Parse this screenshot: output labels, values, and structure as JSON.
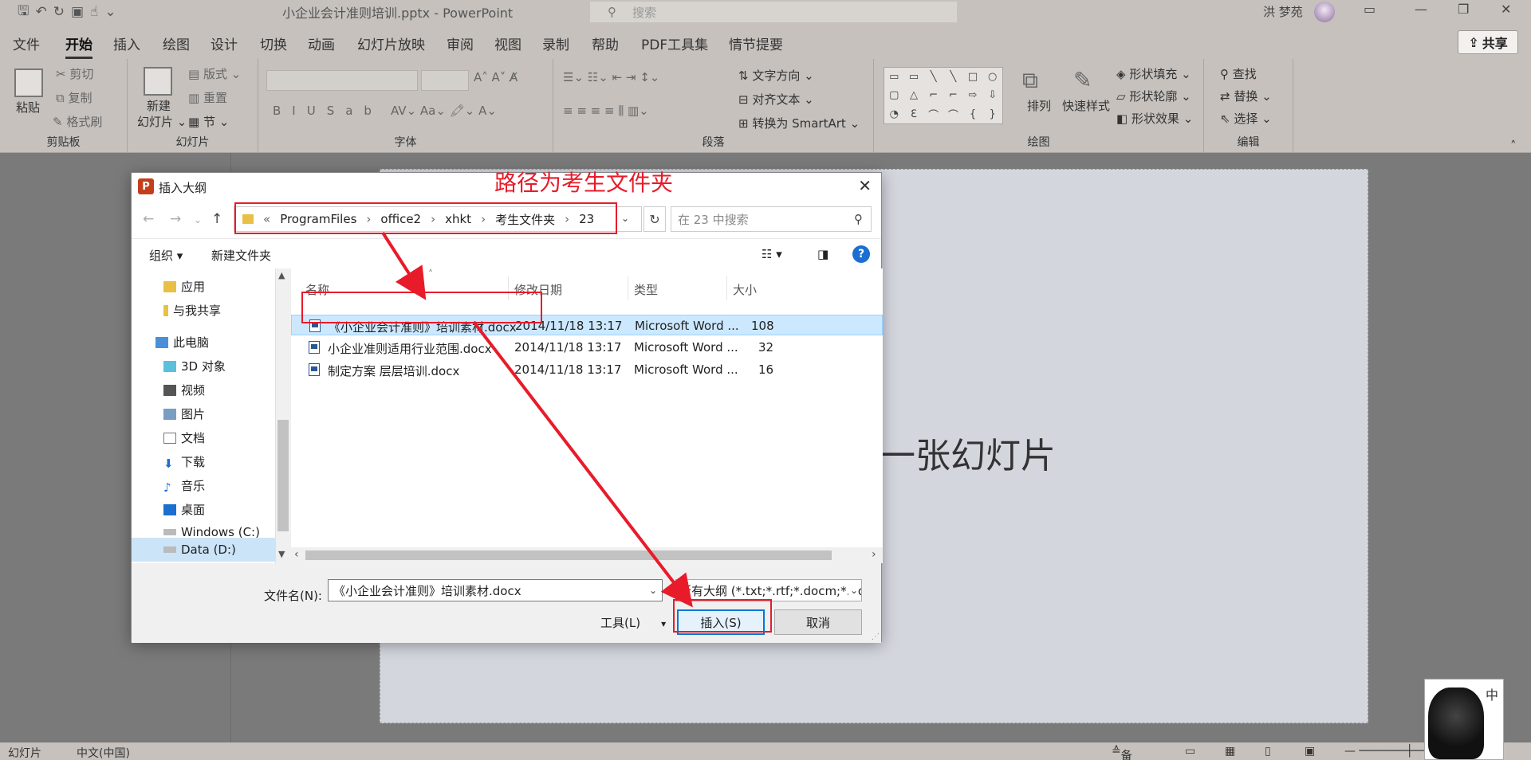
{
  "titlebar": {
    "doc_title": "小企业会计准则培训.pptx  -  PowerPoint",
    "search_placeholder": "搜索",
    "user": "洪 梦苑"
  },
  "menu": {
    "tabs": [
      "文件",
      "开始",
      "插入",
      "绘图",
      "设计",
      "切换",
      "动画",
      "幻灯片放映",
      "审阅",
      "视图",
      "录制",
      "帮助",
      "PDF工具集",
      "情节提要"
    ],
    "share": "共享"
  },
  "ribbon": {
    "clipboard": {
      "label": "剪贴板",
      "paste": "粘贴",
      "cut": "剪切",
      "copy": "复制",
      "format_painter": "格式刷"
    },
    "slides": {
      "label": "幻灯片",
      "new_slide": "新建",
      "new_slide2": "幻灯片",
      "layout": "版式",
      "reset": "重置",
      "section": "节"
    },
    "font": {
      "label": "字体"
    },
    "paragraph": {
      "label": "段落",
      "text_direction": "文字方向",
      "align_text": "对齐文本",
      "smartart": "转换为 SmartArt"
    },
    "drawing": {
      "label": "绘图",
      "arrange": "排列",
      "quick_styles": "快速样式",
      "shape_fill": "形状填充",
      "shape_outline": "形状轮廓",
      "shape_effects": "形状效果"
    },
    "editing": {
      "label": "编辑",
      "find": "查找",
      "replace": "替换",
      "select": "选择"
    }
  },
  "slide": {
    "title": "第一张幻灯片"
  },
  "statusbar": {
    "slide": "幻灯片",
    "language": "中文(中国)",
    "notes": "备注"
  },
  "ime": {
    "mode": "中"
  },
  "dialog": {
    "title": "插入大纲",
    "path": [
      "ProgramFiles",
      "office2",
      "xhkt",
      "考生文件夹",
      "23"
    ],
    "search_placeholder": "在 23 中搜索",
    "organize": "组织",
    "new_folder": "新建文件夹",
    "nav": [
      "应用",
      "与我共享",
      "此电脑",
      "3D 对象",
      "视频",
      "图片",
      "文档",
      "下载",
      "音乐",
      "桌面",
      "Windows (C:)",
      "Data (D:)"
    ],
    "columns": [
      "名称",
      "修改日期",
      "类型",
      "大小"
    ],
    "files": [
      {
        "name": "《小企业会计准则》培训素材.docx",
        "date": "2014/11/18 13:17",
        "type": "Microsoft Word ...",
        "size": "108"
      },
      {
        "name": "小企业准则适用行业范围.docx",
        "date": "2014/11/18 13:17",
        "type": "Microsoft Word ...",
        "size": "32"
      },
      {
        "name": "制定方案 层层培训.docx",
        "date": "2014/11/18 13:17",
        "type": "Microsoft Word ...",
        "size": "16"
      }
    ],
    "filename_label": "文件名(N):",
    "filename_value": "《小企业会计准则》培训素材.docx",
    "filetype": "所有大纲 (*.txt;*.rtf;*.docm;*.docx",
    "tools": "工具(L)",
    "insert": "插入(S)",
    "cancel": "取消"
  },
  "annotation": {
    "text": "路径为考生文件夹",
    "color": "#e81b2a"
  }
}
